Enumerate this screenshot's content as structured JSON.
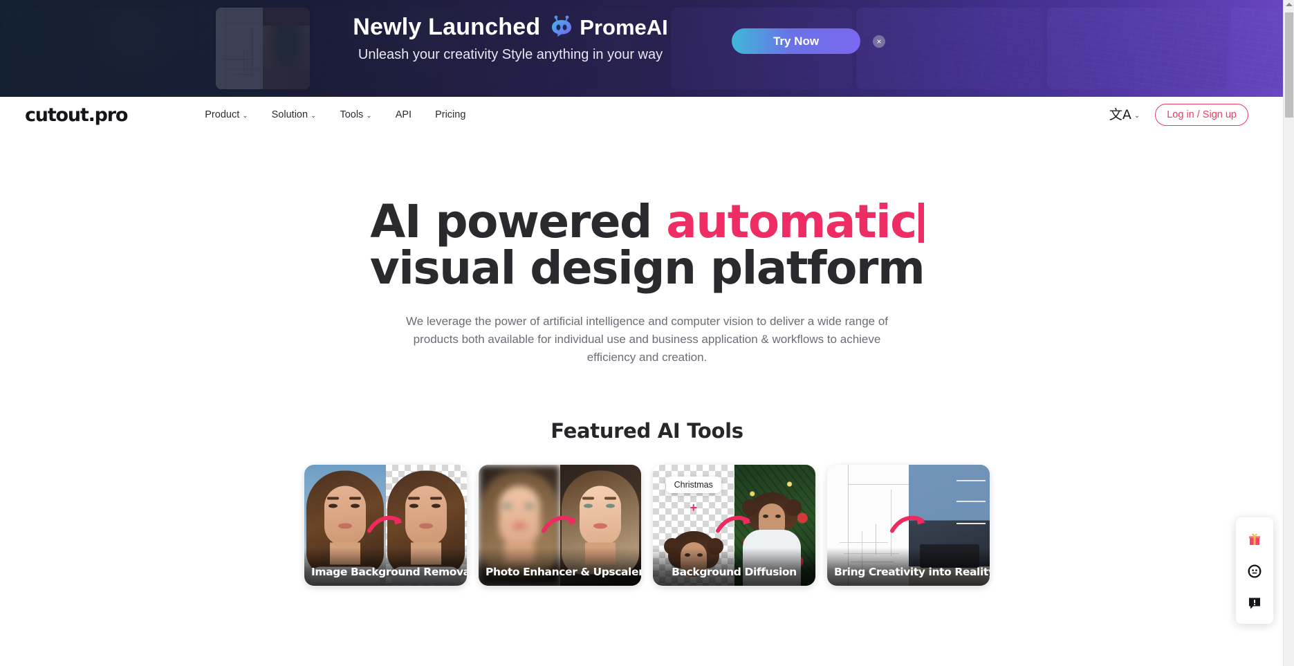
{
  "promo": {
    "title": "Newly Launched",
    "brand": "PromeAI",
    "brand_icon": "robot-head-icon",
    "subtitle": "Unleash your creativity Style anything in your way",
    "cta_label": "Try Now",
    "close_label": "×",
    "colors": {
      "cta_from": "#3fb8d8",
      "cta_to": "#7b68f0"
    }
  },
  "nav": {
    "logo": "cutout.pro",
    "links": [
      {
        "label": "Product",
        "has_dropdown": true
      },
      {
        "label": "Solution",
        "has_dropdown": true
      },
      {
        "label": "Tools",
        "has_dropdown": true
      },
      {
        "label": "API",
        "has_dropdown": false
      },
      {
        "label": "Pricing",
        "has_dropdown": false
      }
    ],
    "chevron": "⌄",
    "language": {
      "glyph": "文A",
      "chevron": "⌄"
    },
    "login_label": "Log in / Sign up",
    "accent_color": "#ef3a63"
  },
  "hero": {
    "headline_part1": "AI powered ",
    "headline_accent": "automatic",
    "headline_line2": "visual design platform",
    "subhead": "We leverage the power of artificial intelligence and computer vision to deliver a wide range of products both available for individual use and business application & workflows to achieve efficiency and creation.",
    "accent_color": "#ed2d63"
  },
  "featured": {
    "title": "Featured AI Tools",
    "cards": [
      {
        "label": "Image Background Removal"
      },
      {
        "label": "Photo Enhancer & Upscaler"
      },
      {
        "label": "Background Diffusion",
        "chip": "Christmas",
        "plus": "+"
      },
      {
        "label": "Bring Creativity into Reality"
      }
    ]
  },
  "side_panel": {
    "buttons": [
      {
        "name": "gift-icon",
        "glyph": "🎁"
      },
      {
        "name": "support-agent-icon",
        "glyph": "☺"
      },
      {
        "name": "feedback-icon",
        "glyph": "🗨"
      }
    ]
  }
}
